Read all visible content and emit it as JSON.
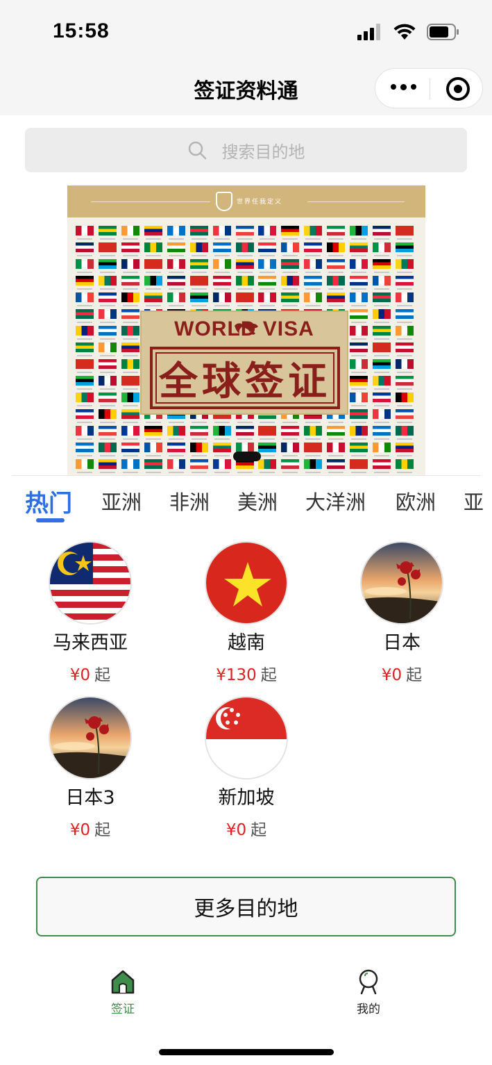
{
  "status_bar": {
    "time": "15:58"
  },
  "nav": {
    "title": "签证资料通"
  },
  "search": {
    "placeholder": "搜索目的地"
  },
  "banner": {
    "brand_text": "世界任我定义",
    "title_en": "WORLD    VISA",
    "title_cn": "全球签证"
  },
  "tabs": [
    "热门",
    "亚洲",
    "非洲",
    "美洲",
    "大洋洲",
    "欧洲",
    "亚"
  ],
  "active_tab": "热门",
  "destinations": [
    {
      "name": "马来西亚",
      "price": "¥0",
      "unit": "起",
      "flag": "malaysia-flag"
    },
    {
      "name": "越南",
      "price": "¥130",
      "unit": "起",
      "flag": "vietnam-flag"
    },
    {
      "name": "日本",
      "price": "¥0",
      "unit": "起",
      "flag": "sunset-flower-photo"
    },
    {
      "name": "日本3",
      "price": "¥0",
      "unit": "起",
      "flag": "sunset-flower-photo"
    },
    {
      "name": "新加坡",
      "price": "¥0",
      "unit": "起",
      "flag": "singapore-flag"
    }
  ],
  "more_button": "更多目的地",
  "tabbar": [
    {
      "label": "签证",
      "icon": "home-icon",
      "active": true
    },
    {
      "label": "我的",
      "icon": "profile-icon",
      "active": false
    }
  ],
  "colors": {
    "accent_blue": "#2f6fe4",
    "price_red": "#e02020",
    "green": "#3f8d4a"
  }
}
